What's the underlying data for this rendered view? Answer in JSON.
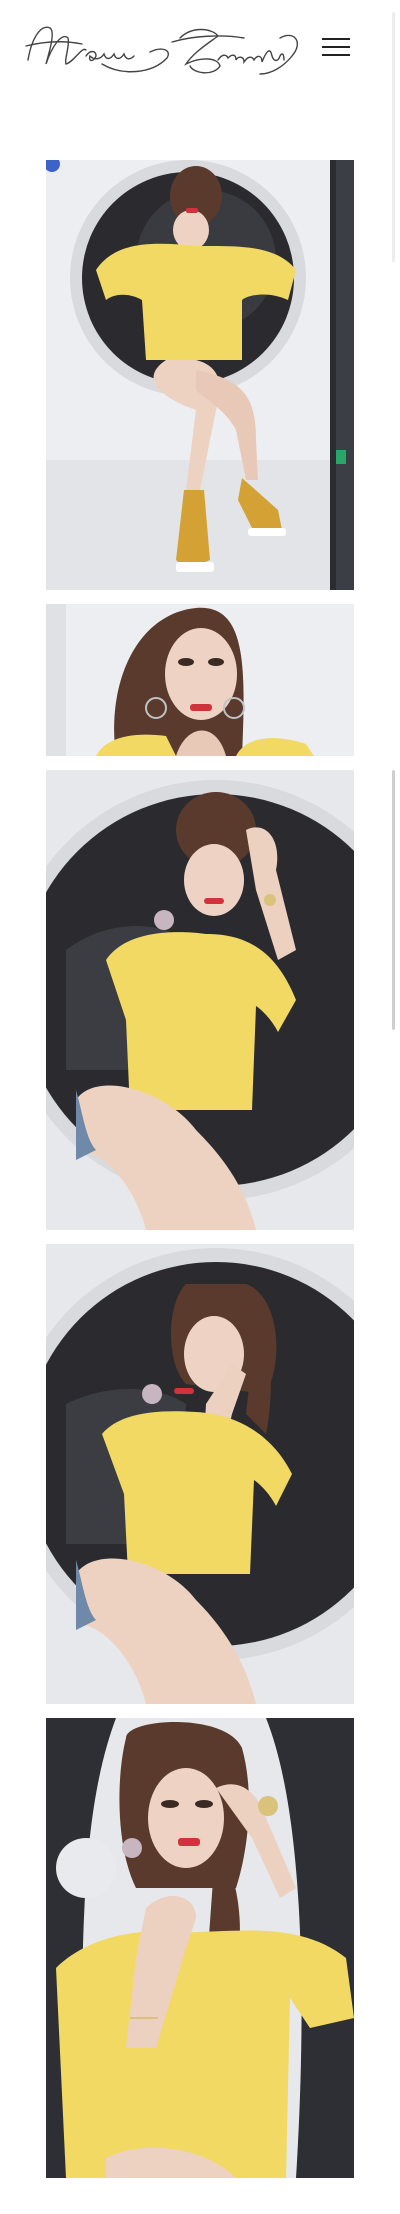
{
  "header": {
    "brand_name": "Naimi Tzrasaki",
    "logo_icon": "signature-logo",
    "menu_icon": "hamburger-menu-icon"
  },
  "colors": {
    "background": "#ffffff",
    "sweater": "#f2d964",
    "drum_dark": "#2b2b2f",
    "wall": "#e9ebee",
    "skin": "#eed3c4",
    "hair": "#5a3a2c",
    "lips": "#d2323c"
  },
  "gallery": {
    "photos": [
      {
        "name": "photo-washing-machine-sitting-full",
        "icon": "photo-image"
      },
      {
        "name": "photo-portrait-closeup",
        "icon": "photo-image"
      },
      {
        "name": "photo-seated-in-drum-smiling",
        "icon": "photo-image"
      },
      {
        "name": "photo-seated-in-drum-hand-in-hair",
        "icon": "photo-image"
      },
      {
        "name": "photo-portrait-hand-on-chin",
        "icon": "photo-image"
      }
    ]
  }
}
